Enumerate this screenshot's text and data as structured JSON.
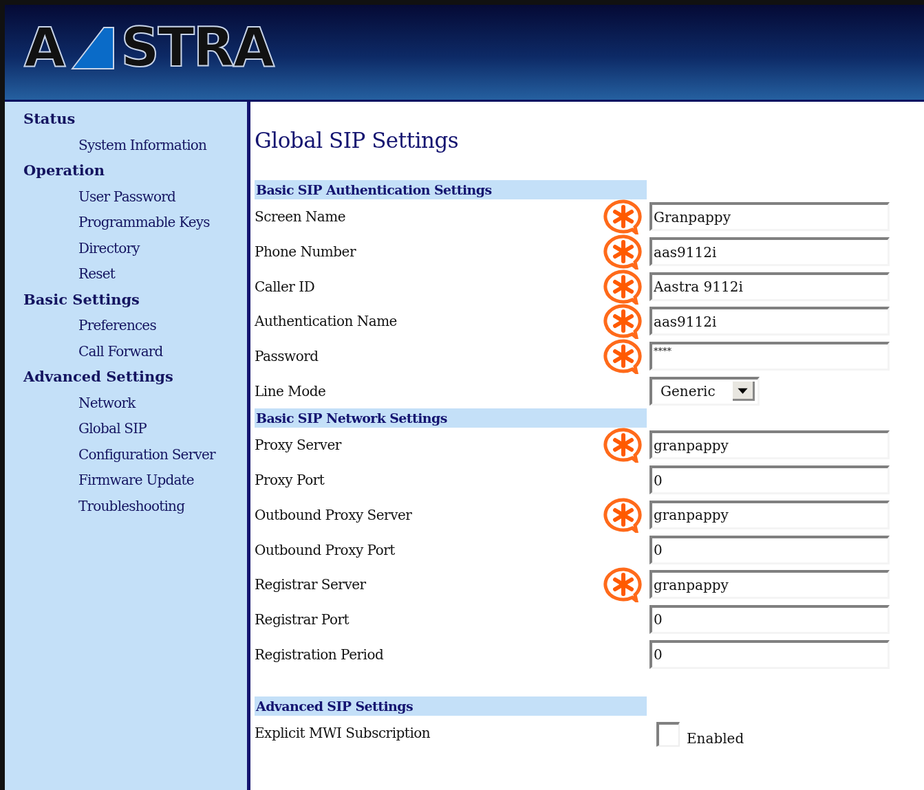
{
  "logo": {
    "left": "A",
    "right": "STRA"
  },
  "sidebar": [
    {
      "label": "Status",
      "children": [
        {
          "label": "System Information"
        }
      ]
    },
    {
      "label": "Operation",
      "children": [
        {
          "label": "User Password"
        },
        {
          "label": "Programmable Keys"
        },
        {
          "label": "Directory"
        },
        {
          "label": "Reset"
        }
      ]
    },
    {
      "label": "Basic Settings",
      "children": [
        {
          "label": "Preferences"
        },
        {
          "label": "Call Forward"
        }
      ]
    },
    {
      "label": "Advanced Settings",
      "children": [
        {
          "label": "Network"
        },
        {
          "label": "Global SIP"
        },
        {
          "label": "Configuration Server"
        },
        {
          "label": "Firmware Update"
        },
        {
          "label": "Troubleshooting"
        }
      ]
    }
  ],
  "page_title": "Global SIP Settings",
  "sections": [
    {
      "title": "Basic SIP Authentication Settings",
      "fields": [
        {
          "kind": "text",
          "label": "Screen Name",
          "required": true,
          "value": "Granpappy"
        },
        {
          "kind": "text",
          "label": "Phone Number",
          "required": true,
          "value": "aas9112i"
        },
        {
          "kind": "text",
          "label": "Caller ID",
          "required": true,
          "value": "Aastra 9112i"
        },
        {
          "kind": "text",
          "label": "Authentication Name",
          "required": true,
          "value": "aas9112i"
        },
        {
          "kind": "password",
          "label": "Password",
          "required": true,
          "value": "****"
        },
        {
          "kind": "select",
          "label": "Line Mode",
          "required": false,
          "value": "Generic"
        }
      ]
    },
    {
      "title": "Basic SIP Network Settings",
      "fields": [
        {
          "kind": "text",
          "label": "Proxy Server",
          "required": true,
          "value": "granpappy"
        },
        {
          "kind": "text",
          "label": "Proxy Port",
          "required": false,
          "value": "0"
        },
        {
          "kind": "text",
          "label": "Outbound Proxy Server",
          "required": true,
          "value": "granpappy"
        },
        {
          "kind": "text",
          "label": "Outbound Proxy Port",
          "required": false,
          "value": "0"
        },
        {
          "kind": "text",
          "label": "Registrar Server",
          "required": true,
          "value": "granpappy"
        },
        {
          "kind": "text",
          "label": "Registrar Port",
          "required": false,
          "value": "0"
        },
        {
          "kind": "text",
          "label": "Registration Period",
          "required": false,
          "value": "0"
        }
      ]
    },
    {
      "title": "Advanced SIP Settings",
      "fields": [
        {
          "kind": "checkbox",
          "label": "Explicit MWI Subscription",
          "required": false,
          "checked": false,
          "option": "Enabled"
        }
      ]
    }
  ]
}
